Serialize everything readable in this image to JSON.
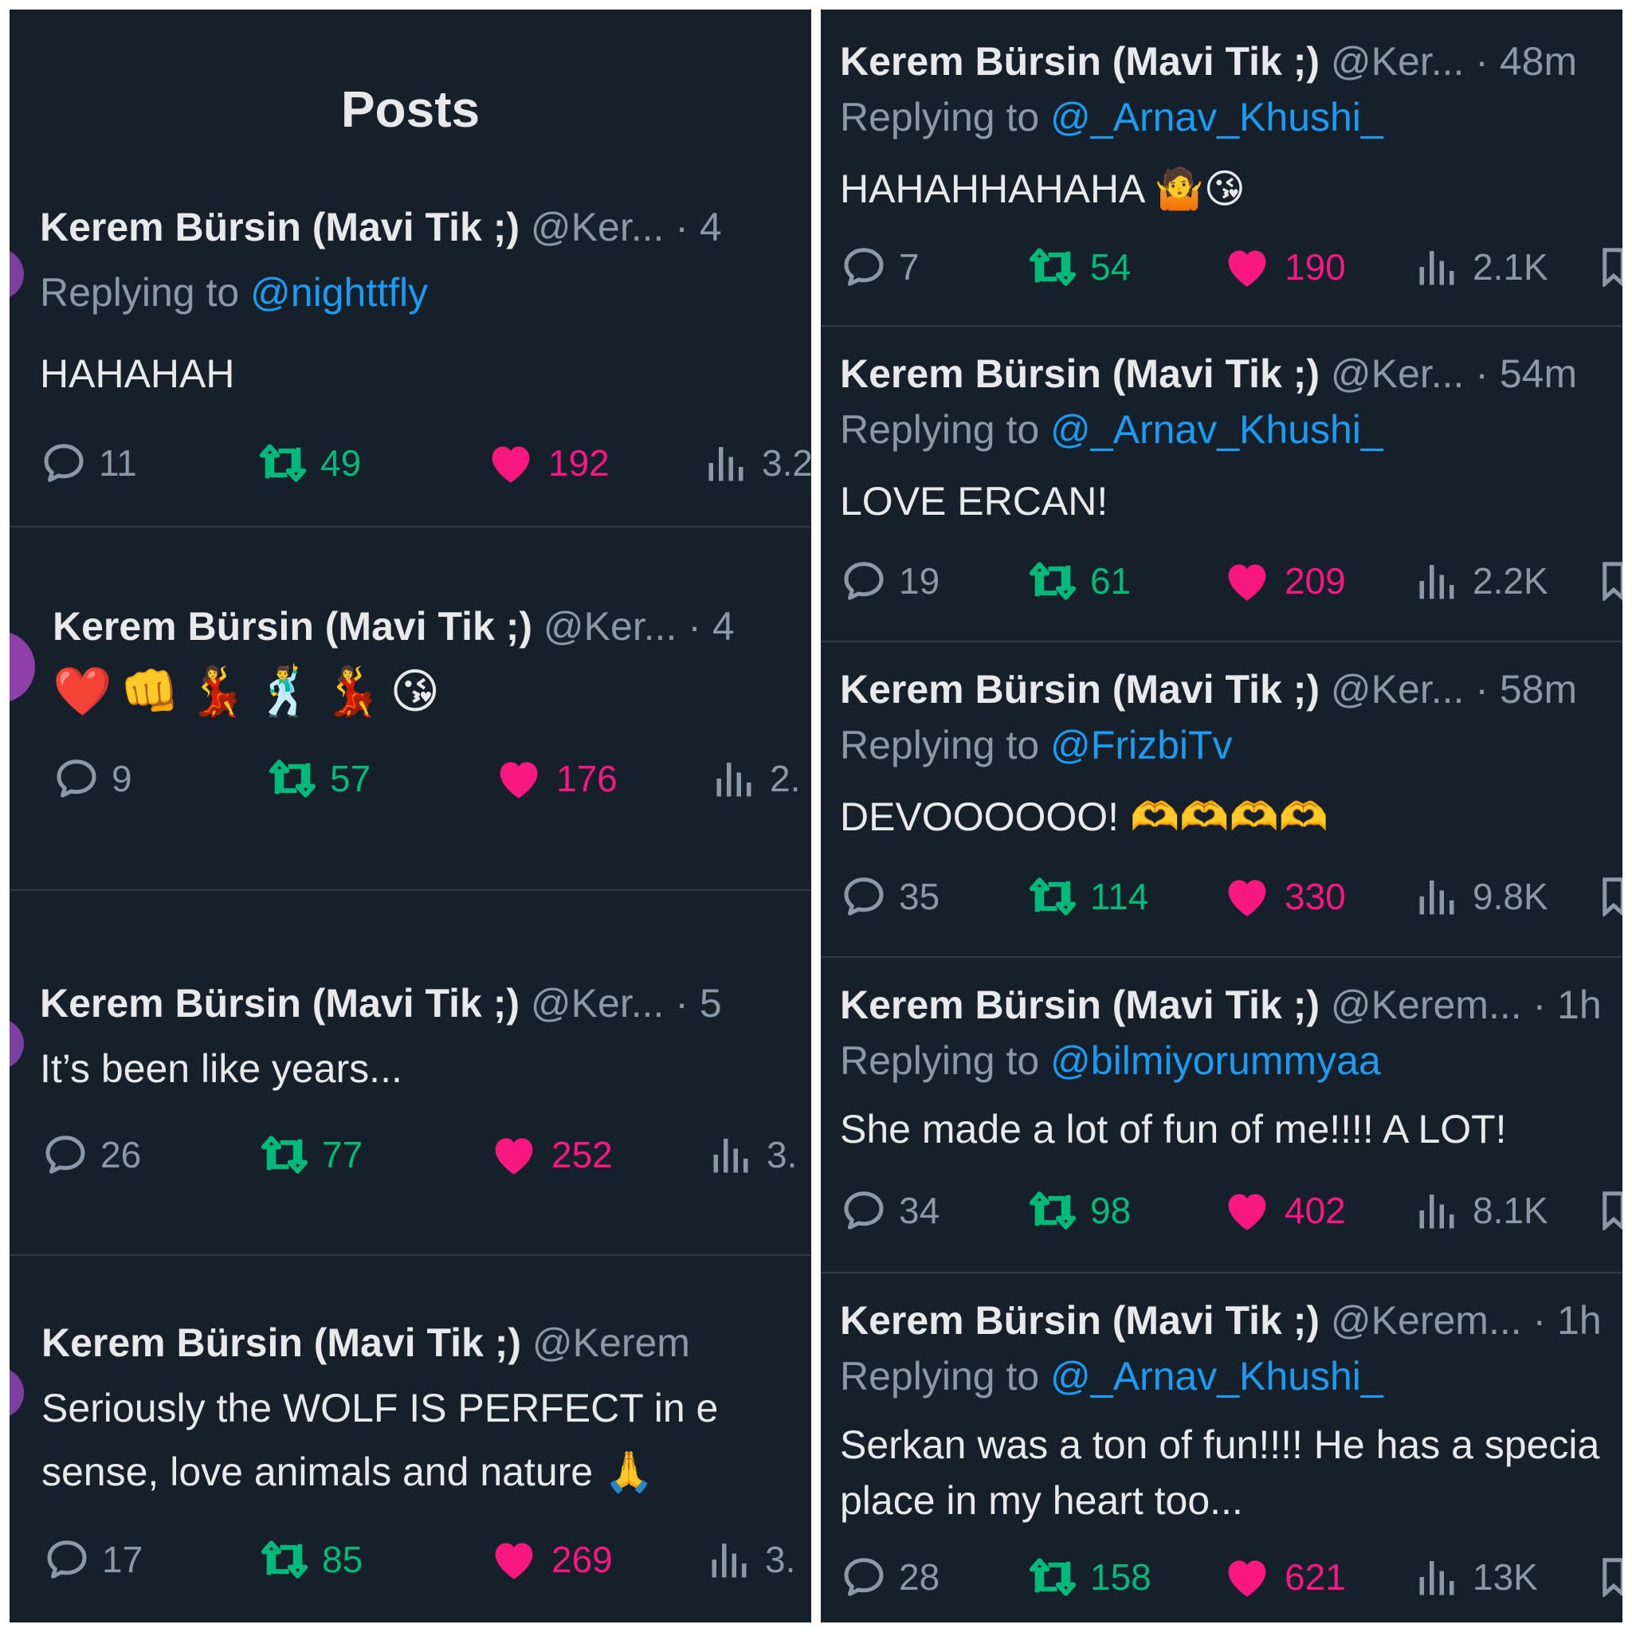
{
  "left": {
    "title": "Posts",
    "posts": [
      {
        "name": "Kerem Bürsin (Mavi Tik ;)",
        "handle": "@Ker... · 4",
        "replying_prefix": "Replying to ",
        "replying_to": "@nighttfly",
        "text": "HAHAHAH",
        "comments": "11",
        "retweets": "49",
        "likes": "192",
        "views": "3.2"
      },
      {
        "name": "Kerem Bürsin (Mavi Tik ;)",
        "handle": "@Ker... · 4",
        "text": "❤️👊💃🕺💃😘",
        "comments": "9",
        "retweets": "57",
        "likes": "176",
        "views": "2."
      },
      {
        "name": "Kerem Bürsin (Mavi Tik ;)",
        "handle": "@Ker... · 5",
        "text": "It’s been like years...",
        "comments": "26",
        "retweets": "77",
        "likes": "252",
        "views": "3."
      },
      {
        "name": "Kerem Bürsin (Mavi Tik ;)",
        "handle": "@Kerem",
        "text_line1": "Seriously the WOLF IS PERFECT in e",
        "text_line2": "sense, love animals and nature 🙏",
        "comments": "17",
        "retweets": "85",
        "likes": "269",
        "views": "3."
      }
    ]
  },
  "right": {
    "posts": [
      {
        "name": "Kerem Bürsin (Mavi Tik ;)",
        "handle": "@Ker... · 48m",
        "replying_prefix": "Replying to ",
        "replying_to": "@_Arnav_Khushi_",
        "text": "HAHAHHAHAHA 🤷😘",
        "comments": "7",
        "retweets": "54",
        "likes": "190",
        "views": "2.1K"
      },
      {
        "name": "Kerem Bürsin (Mavi Tik ;)",
        "handle": "@Ker... · 54m",
        "replying_prefix": "Replying to ",
        "replying_to": "@_Arnav_Khushi_",
        "text": "LOVE ERCAN!",
        "comments": "19",
        "retweets": "61",
        "likes": "209",
        "views": "2.2K"
      },
      {
        "name": "Kerem Bürsin (Mavi Tik ;)",
        "handle": "@Ker... · 58m",
        "replying_prefix": "Replying to ",
        "replying_to": "@FrizbiTv",
        "text": "DEVOOOOOO! 🫶🫶🫶🫶",
        "comments": "35",
        "retweets": "114",
        "likes": "330",
        "views": "9.8K"
      },
      {
        "name": "Kerem Bürsin (Mavi Tik ;)",
        "handle": "@Kerem... · 1h",
        "replying_prefix": "Replying to ",
        "replying_to": "@bilmiyorummyaa",
        "text": "She made a lot of fun of me!!!! A LOT!",
        "comments": "34",
        "retweets": "98",
        "likes": "402",
        "views": "8.1K"
      },
      {
        "name": "Kerem Bürsin (Mavi Tik ;)",
        "handle": "@Kerem... · 1h",
        "replying_prefix": "Replying to ",
        "replying_to": "@_Arnav_Khushi_",
        "text_line1": "Serkan was a ton of fun!!!! He has a specia",
        "text_line2": "place in my heart too...",
        "comments": "28",
        "retweets": "158",
        "likes": "621",
        "views": "13K"
      }
    ]
  },
  "icons": [
    "reply-icon",
    "retweet-icon",
    "like-icon",
    "views-icon",
    "bookmark-icon"
  ],
  "colors": {
    "background": "#15202b",
    "text": "#e7e9ea",
    "muted": "#8b98a5",
    "link": "#1d9bf0",
    "retweet": "#00ba7c",
    "like": "#f91880"
  }
}
